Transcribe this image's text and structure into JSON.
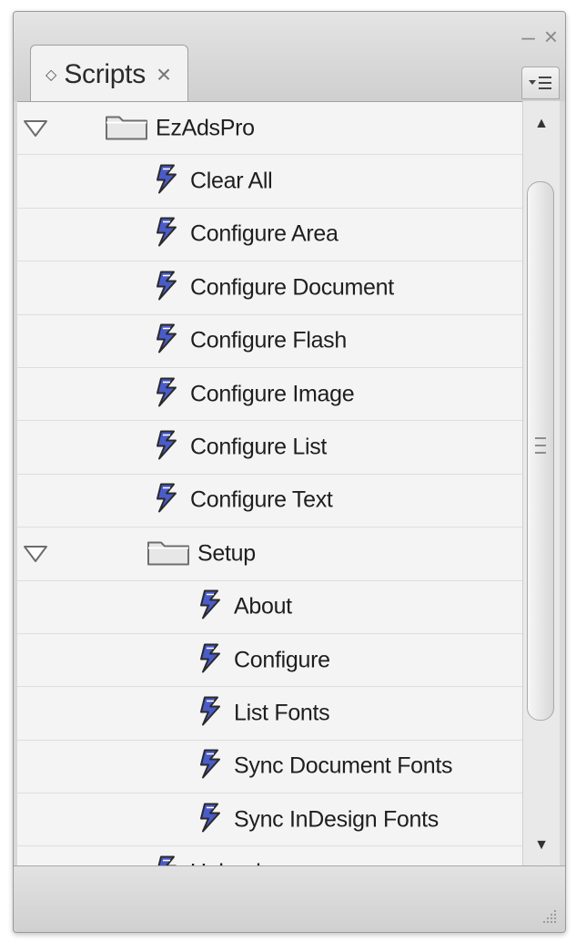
{
  "window": {
    "minimize_glyph": "–",
    "close_glyph": "×"
  },
  "panel": {
    "tab_label": "Scripts",
    "tab_close_glyph": "×",
    "tab_diamond_glyph": "◇",
    "menu_glyph": "▾☰"
  },
  "items": [
    {
      "label": "EzAdsPro",
      "type": "folder",
      "level": 0,
      "expanded": true
    },
    {
      "label": "Clear All",
      "type": "script",
      "level": 1
    },
    {
      "label": "Configure Area",
      "type": "script",
      "level": 1
    },
    {
      "label": "Configure Document",
      "type": "script",
      "level": 1
    },
    {
      "label": "Configure Flash",
      "type": "script",
      "level": 1
    },
    {
      "label": "Configure Image",
      "type": "script",
      "level": 1
    },
    {
      "label": "Configure List",
      "type": "script",
      "level": 1
    },
    {
      "label": "Configure Text",
      "type": "script",
      "level": 1
    },
    {
      "label": "Setup",
      "type": "folder",
      "level": 1,
      "expanded": true
    },
    {
      "label": "About",
      "type": "script",
      "level": 2
    },
    {
      "label": "Configure",
      "type": "script",
      "level": 2
    },
    {
      "label": "List Fonts",
      "type": "script",
      "level": 2
    },
    {
      "label": "Sync Document Fonts",
      "type": "script",
      "level": 2
    },
    {
      "label": "Sync InDesign Fonts",
      "type": "script",
      "level": 2
    },
    {
      "label": "Upload",
      "type": "script",
      "level": 1
    }
  ],
  "scrollbar": {
    "up_glyph": "▲",
    "down_glyph": "▼"
  },
  "colors": {
    "script_icon_blue": "#4a5cc9",
    "script_icon_dark": "#2a2a2a",
    "folder_fill": "#e7e7e7",
    "folder_stroke": "#6e6e6e"
  }
}
